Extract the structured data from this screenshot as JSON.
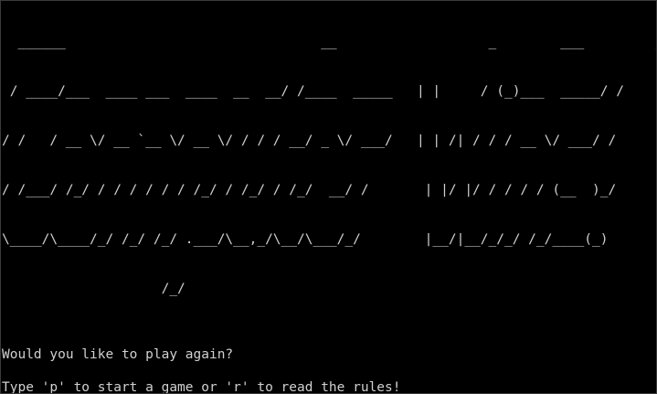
{
  "terminal": {
    "banner_lines": [
      "  ______                                __                   _        ___         __",
      " / ____/___  ____ ___  ____  __  __/ /____  _____   | |     / (_)___  _____/ /",
      "/ /   / __ \\/ __ `__ \\/ __ \\/ / / / __/ _ \\/ ___/   | | /| / / / __ \\/ ___/ / ",
      "/ /___/ /_/ / / / / / / /_/ / /_/ / /_/  __/ /       | |/ |/ / / / / (__  )_/  ",
      "\\____/\\____/_/ /_/ /_/ .___/\\__,_/\\__/\\___/_/        |__/|__/_/_/ /_/____(_)   ",
      "                    /_/"
    ],
    "question": "Would you like to play again?",
    "instruction": "Type 'p' to start a game or 'r' to read the rules!",
    "prompt_symbol": ">"
  }
}
